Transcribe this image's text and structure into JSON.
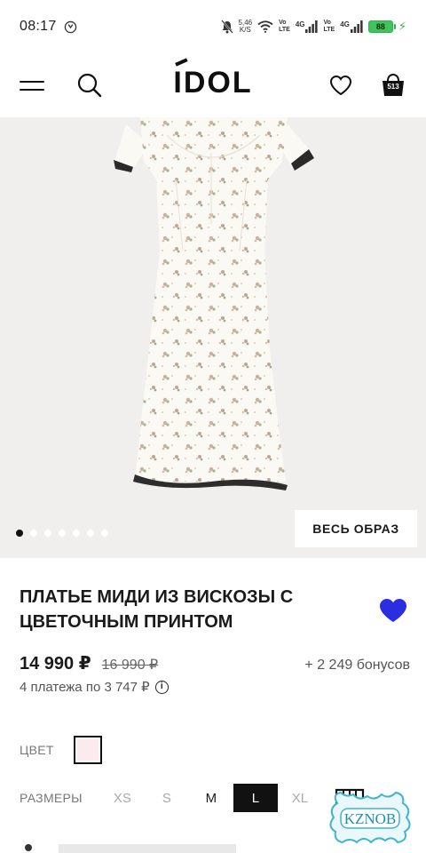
{
  "status_bar": {
    "time": "08:17",
    "net_speed_value": "5,46",
    "net_speed_unit": "K/S",
    "sim1_tag_top": "Vo",
    "sim1_tag_bottom": "LTE",
    "sim1_gen": "4G",
    "sim2_tag_top": "Vo",
    "sim2_tag_bottom": "LTE",
    "sim2_gen": "4G",
    "battery_level": "88",
    "battery_color": "#3ec45a"
  },
  "header": {
    "logo_text": "IDOL",
    "cart_count": "513",
    "icons": [
      "menu-icon",
      "search-icon",
      "heart-icon",
      "shopping-bag-icon"
    ]
  },
  "gallery": {
    "slide_count": 7,
    "active_slide": 0,
    "look_button_label": "ВЕСЬ ОБРАЗ",
    "background": "#f0efed"
  },
  "product": {
    "title": "ПЛАТЬЕ МИДИ ИЗ ВИСКОЗЫ С ЦВЕТОЧНЫМ ПРИНТОМ",
    "wishlist_color": "#2a2ee0",
    "price": "14 990 ₽",
    "old_price": "16 990 ₽",
    "bonus": "+ 2 249 бонусов",
    "installments": "4 платежа по 3 747 ₽",
    "info_glyph": "i"
  },
  "options": {
    "color_label": "ЦВЕТ",
    "selected_color": "#fbeaee",
    "sizes_label": "РАЗМЕРЫ",
    "sizes": [
      {
        "label": "XS",
        "available": false
      },
      {
        "label": "S",
        "available": false
      },
      {
        "label": "M",
        "available": true
      },
      {
        "label": "L",
        "available": true,
        "selected": true
      },
      {
        "label": "XL",
        "available": false
      }
    ]
  },
  "watermark": {
    "text": "KZNOB"
  }
}
